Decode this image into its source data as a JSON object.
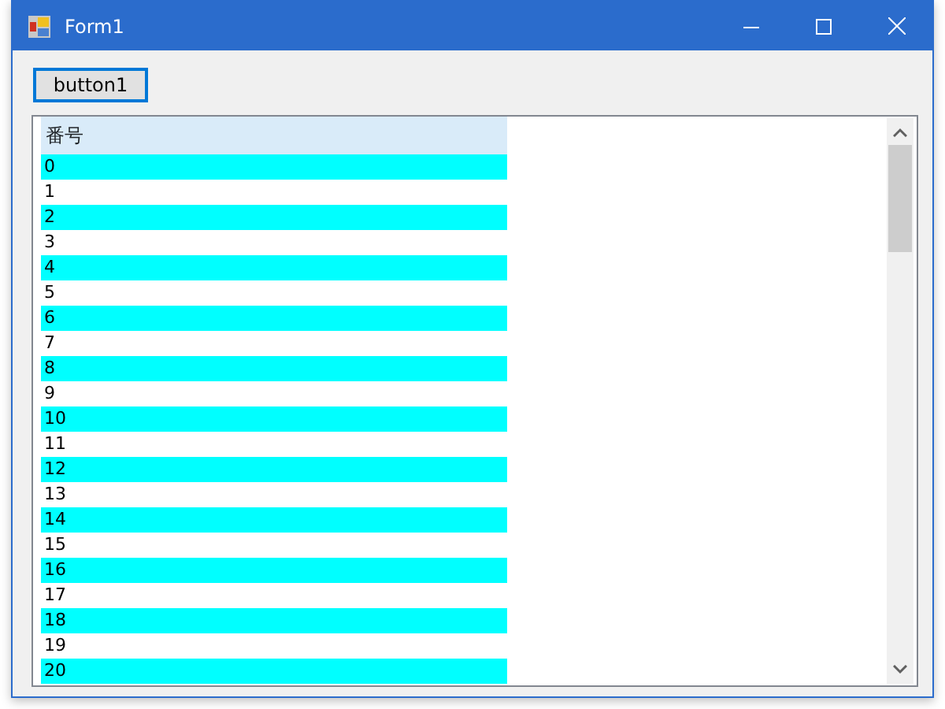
{
  "window": {
    "title": "Form1"
  },
  "button": {
    "label": "button1"
  },
  "list": {
    "columns": [
      "番号"
    ],
    "rows": [
      {
        "cells": [
          "0"
        ],
        "color": "#00ffff"
      },
      {
        "cells": [
          "1"
        ],
        "color": "#ffffff"
      },
      {
        "cells": [
          "2"
        ],
        "color": "#00ffff"
      },
      {
        "cells": [
          "3"
        ],
        "color": "#ffffff"
      },
      {
        "cells": [
          "4"
        ],
        "color": "#00ffff"
      },
      {
        "cells": [
          "5"
        ],
        "color": "#ffffff"
      },
      {
        "cells": [
          "6"
        ],
        "color": "#00ffff"
      },
      {
        "cells": [
          "7"
        ],
        "color": "#ffffff"
      },
      {
        "cells": [
          "8"
        ],
        "color": "#00ffff"
      },
      {
        "cells": [
          "9"
        ],
        "color": "#ffffff"
      },
      {
        "cells": [
          "10"
        ],
        "color": "#00ffff"
      },
      {
        "cells": [
          "11"
        ],
        "color": "#ffffff"
      },
      {
        "cells": [
          "12"
        ],
        "color": "#00ffff"
      },
      {
        "cells": [
          "13"
        ],
        "color": "#ffffff"
      },
      {
        "cells": [
          "14"
        ],
        "color": "#00ffff"
      },
      {
        "cells": [
          "15"
        ],
        "color": "#ffffff"
      },
      {
        "cells": [
          "16"
        ],
        "color": "#00ffff"
      },
      {
        "cells": [
          "17"
        ],
        "color": "#ffffff"
      },
      {
        "cells": [
          "18"
        ],
        "color": "#00ffff"
      },
      {
        "cells": [
          "19"
        ],
        "color": "#ffffff"
      },
      {
        "cells": [
          "20"
        ],
        "color": "#00ffff"
      }
    ]
  }
}
